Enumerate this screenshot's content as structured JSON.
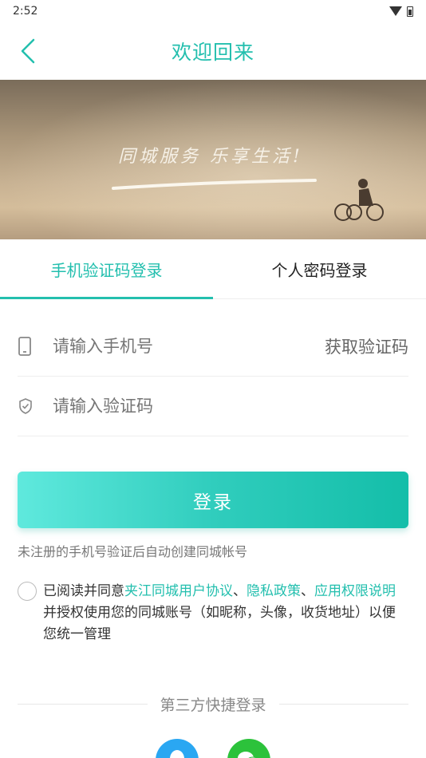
{
  "status": {
    "time": "2:52"
  },
  "header": {
    "title": "欢迎回来"
  },
  "banner": {
    "slogan": "同城服务 乐享生活!"
  },
  "tabs": [
    {
      "label": "手机验证码登录",
      "active": true
    },
    {
      "label": "个人密码登录",
      "active": false
    }
  ],
  "form": {
    "phone_placeholder": "请输入手机号",
    "get_code_label": "获取验证码",
    "code_placeholder": "请输入验证码"
  },
  "login_label": "登录",
  "hint": "未注册的手机号验证后自动创建同城帐号",
  "agreement": {
    "prefix": "已阅读并同意",
    "link1": "夹江同城用户协议",
    "sep1": "、",
    "link2": "隐私政策",
    "sep2": "、",
    "link3": "应用权限说明",
    "suffix": "并授权使用您的同城账号（如昵称，头像，收货地址）以便您统一管理"
  },
  "third_party_label": "第三方快捷登录",
  "socials": [
    {
      "icon": "qq-icon",
      "color": "#2aa7f2"
    },
    {
      "icon": "wechat-icon",
      "color": "#2cc23b"
    }
  ],
  "colors": {
    "accent": "#23bfae"
  }
}
